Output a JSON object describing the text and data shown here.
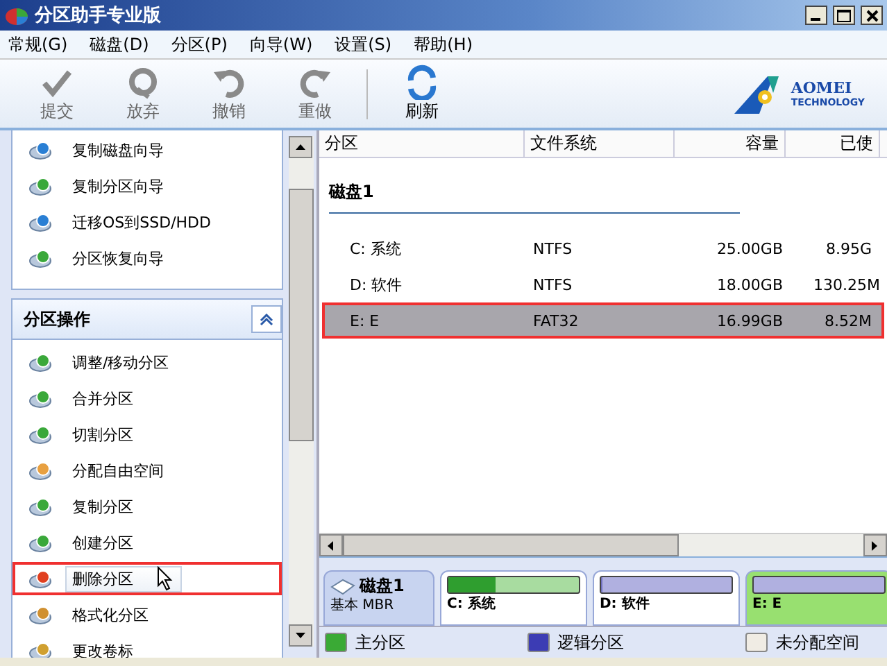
{
  "window": {
    "title": "分区助手专业版"
  },
  "menu": [
    "常规(G)",
    "磁盘(D)",
    "分区(P)",
    "向导(W)",
    "设置(S)",
    "帮助(H)"
  ],
  "toolbar": [
    {
      "label": "提交",
      "kind": "commit",
      "disabled": true
    },
    {
      "label": "放弃",
      "kind": "discard",
      "disabled": true
    },
    {
      "label": "撤销",
      "kind": "undo",
      "disabled": true
    },
    {
      "label": "重做",
      "kind": "redo",
      "disabled": true
    },
    {
      "label": "刷新",
      "kind": "refresh",
      "disabled": false
    }
  ],
  "logo": {
    "name": "AOMEI",
    "sub": "TECHNOLOGY"
  },
  "wizards": [
    "复制磁盘向导",
    "复制分区向导",
    "迁移OS到SSD/HDD",
    "分区恢复向导"
  ],
  "operations": {
    "title": "分区操作",
    "items": [
      {
        "label": "调整/移动分区",
        "highlighted": false
      },
      {
        "label": "合并分区",
        "highlighted": false
      },
      {
        "label": "切割分区",
        "highlighted": false
      },
      {
        "label": "分配自由空间",
        "highlighted": false
      },
      {
        "label": "复制分区",
        "highlighted": false
      },
      {
        "label": "创建分区",
        "highlighted": false
      },
      {
        "label": "删除分区",
        "highlighted": true
      },
      {
        "label": "格式化分区",
        "highlighted": false
      },
      {
        "label": "更改卷标",
        "highlighted": false
      }
    ]
  },
  "table": {
    "columns": [
      "分区",
      "文件系统",
      "容量",
      "已使"
    ],
    "group": "磁盘1",
    "rows": [
      {
        "cells": [
          "C: 系统",
          "NTFS",
          "25.00GB",
          "8.95G"
        ],
        "selected": false
      },
      {
        "cells": [
          "D: 软件",
          "NTFS",
          "18.00GB",
          "130.25M"
        ],
        "selected": false
      },
      {
        "cells": [
          "E: E",
          "FAT32",
          "16.99GB",
          "8.52M"
        ],
        "selected": true
      }
    ]
  },
  "disk_map": {
    "disk": "磁盘1",
    "type": "基本 MBR",
    "partitions": [
      {
        "label": "C: 系统",
        "kind": "primary",
        "level": 0.36,
        "selected": false
      },
      {
        "label": "D: 软件",
        "kind": "logical",
        "level": 0.01,
        "selected": false
      },
      {
        "label": "E: E",
        "kind": "logical",
        "selected": true
      }
    ]
  },
  "legend": [
    {
      "label": "主分区",
      "color": "#3aaa35"
    },
    {
      "label": "逻辑分区",
      "color": "#3c3cb4"
    },
    {
      "label": "未分配空间",
      "color": "#f0ece4"
    }
  ]
}
